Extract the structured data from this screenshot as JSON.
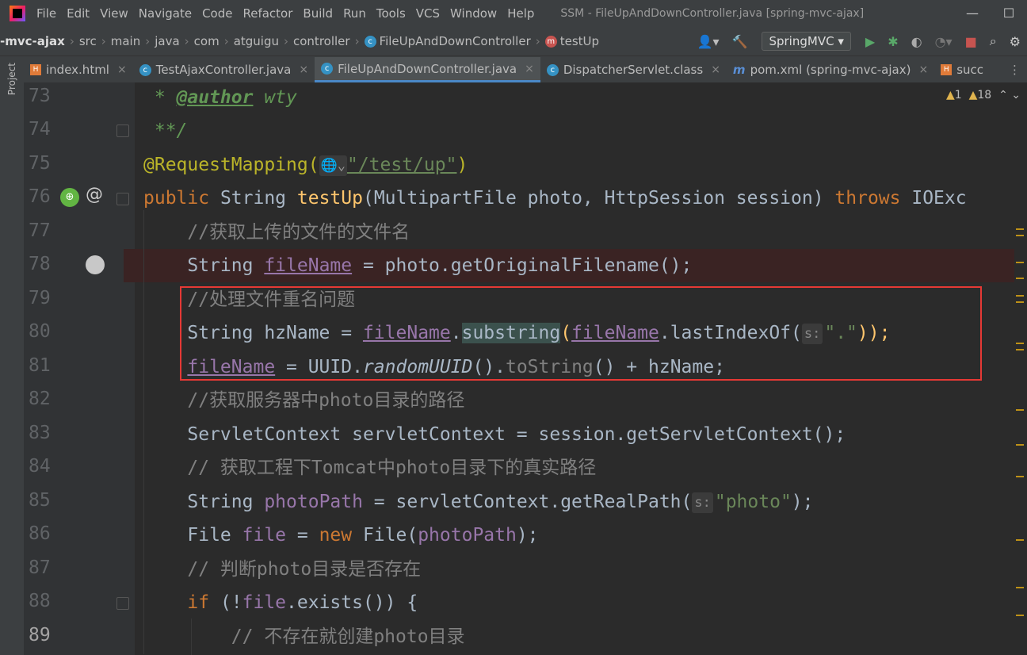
{
  "menubar": {
    "menus": [
      "File",
      "Edit",
      "View",
      "Navigate",
      "Code",
      "Refactor",
      "Build",
      "Run",
      "Tools",
      "VCS",
      "Window",
      "Help"
    ],
    "title": "SSM - FileUpAndDownController.java [spring-mvc-ajax]",
    "min": "—",
    "max": "☐"
  },
  "breadcrumb": {
    "items": [
      "-mvc-ajax",
      "src",
      "main",
      "java",
      "com",
      "atguigu",
      "controller",
      "FileUpAndDownController",
      "testUp"
    ],
    "class_icon": "c",
    "method_icon": "m"
  },
  "toolbar": {
    "run_config": "SpringMVC"
  },
  "tabs": [
    {
      "label": "index.html",
      "icon": "h"
    },
    {
      "label": "TestAjaxController.java",
      "icon": "c"
    },
    {
      "label": "FileUpAndDownController.java",
      "icon": "c",
      "active": true
    },
    {
      "label": "DispatcherServlet.class",
      "icon": "c"
    },
    {
      "label": "pom.xml (spring-mvc-ajax)",
      "icon": "m"
    },
    {
      "label": "succ",
      "icon": "h"
    }
  ],
  "sidebar": {
    "project_label": "Project"
  },
  "inspections": {
    "errors": "1",
    "warnings": "18"
  },
  "lines": [
    "73",
    "74",
    "75",
    "76",
    "77",
    "78",
    "79",
    "80",
    "81",
    "82",
    "83",
    "84",
    "85",
    "86",
    "87",
    "88",
    "89"
  ],
  "code": {
    "l73": [
      " * ",
      "@author",
      " wty"
    ],
    "l74": " **/",
    "l75": [
      "@RequestMapping(",
      "\"/test/up\"",
      ")"
    ],
    "l76": [
      "public ",
      "String ",
      "testUp",
      "(MultipartFile photo, HttpSession session) ",
      "throws ",
      "IOExc"
    ],
    "l77": "    //获取上传的文件的文件名",
    "l78": [
      "    String ",
      "fileName",
      " = photo.getOriginalFilename();"
    ],
    "l79": "    //处理文件重名问题",
    "l80": [
      "    String hzName = ",
      "fileName",
      ".",
      "substring",
      "(",
      "fileName",
      ".lastIndexOf(",
      "\".\"",
      "));"
    ],
    "l81": [
      "    ",
      "fileName",
      " = UUID.",
      "randomUUID",
      "().",
      "toString",
      "() + hzName;"
    ],
    "l82": "    //获取服务器中photo目录的路径",
    "l83": [
      "    ServletContext servletContext = session.getServletContext();"
    ],
    "l84": "    // 获取工程下Tomcat中photo目录下的真实路径",
    "l85": [
      "    String ",
      "photoPath",
      " = servletContext.getRealPath(",
      "\"photo\"",
      ");"
    ],
    "l86": [
      "    File ",
      "file",
      " = ",
      "new ",
      "File(",
      "photoPath",
      ");"
    ],
    "l87": "    // 判断photo目录是否存在",
    "l88": [
      "    ",
      "if ",
      "(!",
      "file",
      ".exists()) {"
    ],
    "l89": "        // 不存在就创建photo目录",
    "hint_s": "s:"
  }
}
